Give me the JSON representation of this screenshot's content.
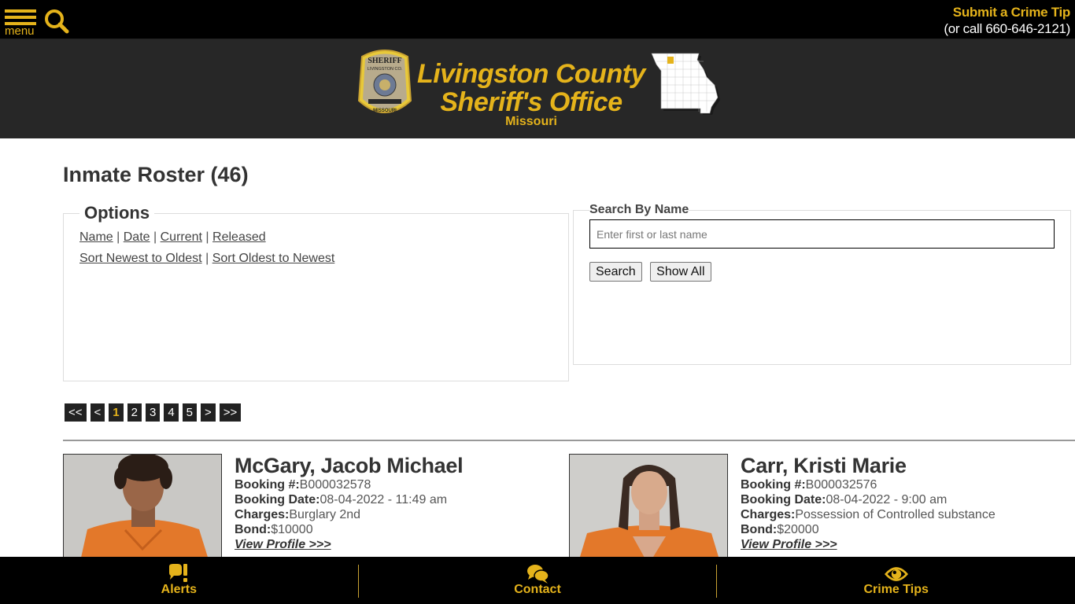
{
  "topbar": {
    "menu_label": "menu",
    "menu_icon": "hamburger-icon",
    "search_icon": "search-icon",
    "tip_title": "Submit a Crime Tip",
    "tip_phone": "(or call 660-646-2121)",
    "accent_color": "#e5b31b"
  },
  "header": {
    "title_line1": "Livingston County",
    "title_line2": "Sheriff's Office",
    "subtitle": "Missouri",
    "badge_icon": "sheriff-badge-icon",
    "map_icon": "missouri-map-icon"
  },
  "main": {
    "title": "Inmate Roster (46)",
    "options": {
      "legend": "Options",
      "filters": [
        "Name",
        "Date",
        "Current",
        "Released"
      ],
      "sorts": [
        "Sort Newest to Oldest",
        "Sort Oldest to Newest"
      ],
      "separator": "|"
    },
    "search": {
      "legend": "Search By Name",
      "placeholder": "Enter first or last name",
      "value": "",
      "search_label": "Search",
      "show_all_label": "Show All"
    },
    "pagination": {
      "first": "<<",
      "prev": "<",
      "pages": [
        "1",
        "2",
        "3",
        "4",
        "5"
      ],
      "current": "1",
      "next": ">",
      "last": ">>"
    },
    "inmates": [
      {
        "name": "McGary, Jacob Michael",
        "booking_number_label": "Booking #:",
        "booking_number": "B000032578",
        "booking_date_label": "Booking Date:",
        "booking_date": "08-04-2022 - 11:49 am",
        "charges_label": "Charges:",
        "charges": "Burglary 2nd",
        "bond_label": "Bond:",
        "bond": "$10000",
        "view_label": "View Profile >>>"
      },
      {
        "name": "Carr, Kristi Marie",
        "booking_number_label": "Booking #:",
        "booking_number": "B000032576",
        "booking_date_label": "Booking Date:",
        "booking_date": "08-04-2022 - 9:00 am",
        "charges_label": "Charges:",
        "charges": "Possession of Controlled substance",
        "bond_label": "Bond:",
        "bond": "$20000",
        "view_label": "View Profile >>>"
      }
    ]
  },
  "bottom_nav": [
    {
      "label": "Alerts",
      "icon": "alert-bubble-icon"
    },
    {
      "label": "Contact",
      "icon": "chat-bubbles-icon"
    },
    {
      "label": "Crime Tips",
      "icon": "eye-icon"
    }
  ]
}
